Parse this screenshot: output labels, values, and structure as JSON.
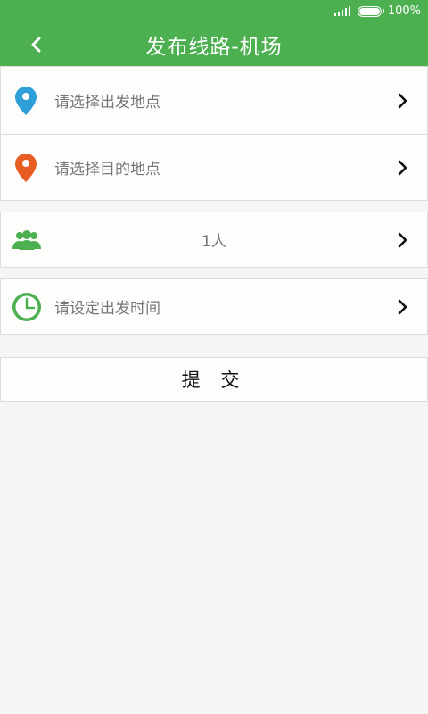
{
  "status_bar": {
    "battery_text": "100%",
    "signal_icon": "signal-icon",
    "battery_icon": "battery-icon"
  },
  "header": {
    "title": "发布线路-机场",
    "back_icon": "chevron-left-icon"
  },
  "form": {
    "departure": {
      "placeholder": "请选择出发地点",
      "icon": "location-pin-icon",
      "icon_color": "#2f9fd8"
    },
    "destination": {
      "placeholder": "请选择目的地点",
      "icon": "location-pin-icon",
      "icon_color": "#e85d22"
    },
    "passengers": {
      "value": "1人",
      "icon": "group-icon",
      "icon_color": "#4caf50"
    },
    "departure_time": {
      "placeholder": "请设定出发时间",
      "icon": "clock-icon",
      "icon_color": "#4caf50"
    }
  },
  "submit_label": "提 交",
  "colors": {
    "primary": "#4caf50",
    "background": "#f5f5f5"
  }
}
